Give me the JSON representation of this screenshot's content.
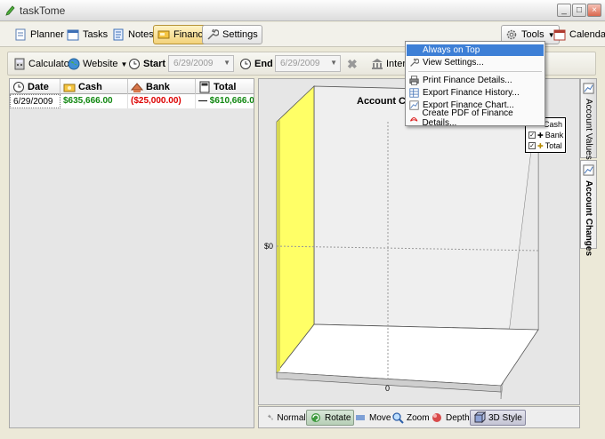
{
  "window": {
    "title": "taskTome"
  },
  "nav": {
    "planner": "Planner",
    "tasks": "Tasks",
    "notes": "Notes",
    "finance": "Finance",
    "settings": "Settings",
    "tools": "Tools",
    "calendar": "Calendar"
  },
  "filters": {
    "calculator": "Calculator",
    "website": "Website",
    "start_label": "Start",
    "start_date": "6/29/2009",
    "end_label": "End",
    "end_date": "6/29/2009",
    "interest": "Interes"
  },
  "table": {
    "headers": [
      "Date",
      "Cash",
      "Bank",
      "Total"
    ],
    "rows": [
      {
        "date": "6/29/2009",
        "cash": "$635,666.00",
        "bank": "($25,000.00)",
        "total_prefix": "—",
        "total": "$610,666.00"
      }
    ]
  },
  "chart": {
    "title": "Account Ch",
    "y_tick": "$0",
    "x_tick": "0",
    "legend": [
      "Cash",
      "Bank",
      "Total"
    ]
  },
  "chart_data": {
    "type": "bar",
    "title": "Account Ch",
    "categories": [
      "0"
    ],
    "series": [
      {
        "name": "Cash",
        "values": [
          635666.0
        ]
      },
      {
        "name": "Bank",
        "values": [
          -25000.0
        ]
      },
      {
        "name": "Total",
        "values": [
          610666.0
        ]
      }
    ],
    "y_ticks": [
      "$0"
    ],
    "legend_position": "top-right",
    "style": "3d"
  },
  "chart_toolbar": {
    "normal": "Normal",
    "rotate": "Rotate",
    "move": "Move",
    "zoom": "Zoom",
    "depth": "Depth",
    "style3d": "3D Style"
  },
  "side_tabs": {
    "values": "Account Values",
    "changes": "Account Changes"
  },
  "tools_menu": {
    "items": [
      "Always on Top",
      "View Settings...",
      "Print Finance Details...",
      "Export Finance History...",
      "Export Finance Chart...",
      "Create PDF of Finance Details..."
    ]
  },
  "colors": {
    "positive": "#118811",
    "negative": "#dd0000",
    "chart_bar": "#ffff66",
    "menu_highlight": "#3d7fd6"
  }
}
